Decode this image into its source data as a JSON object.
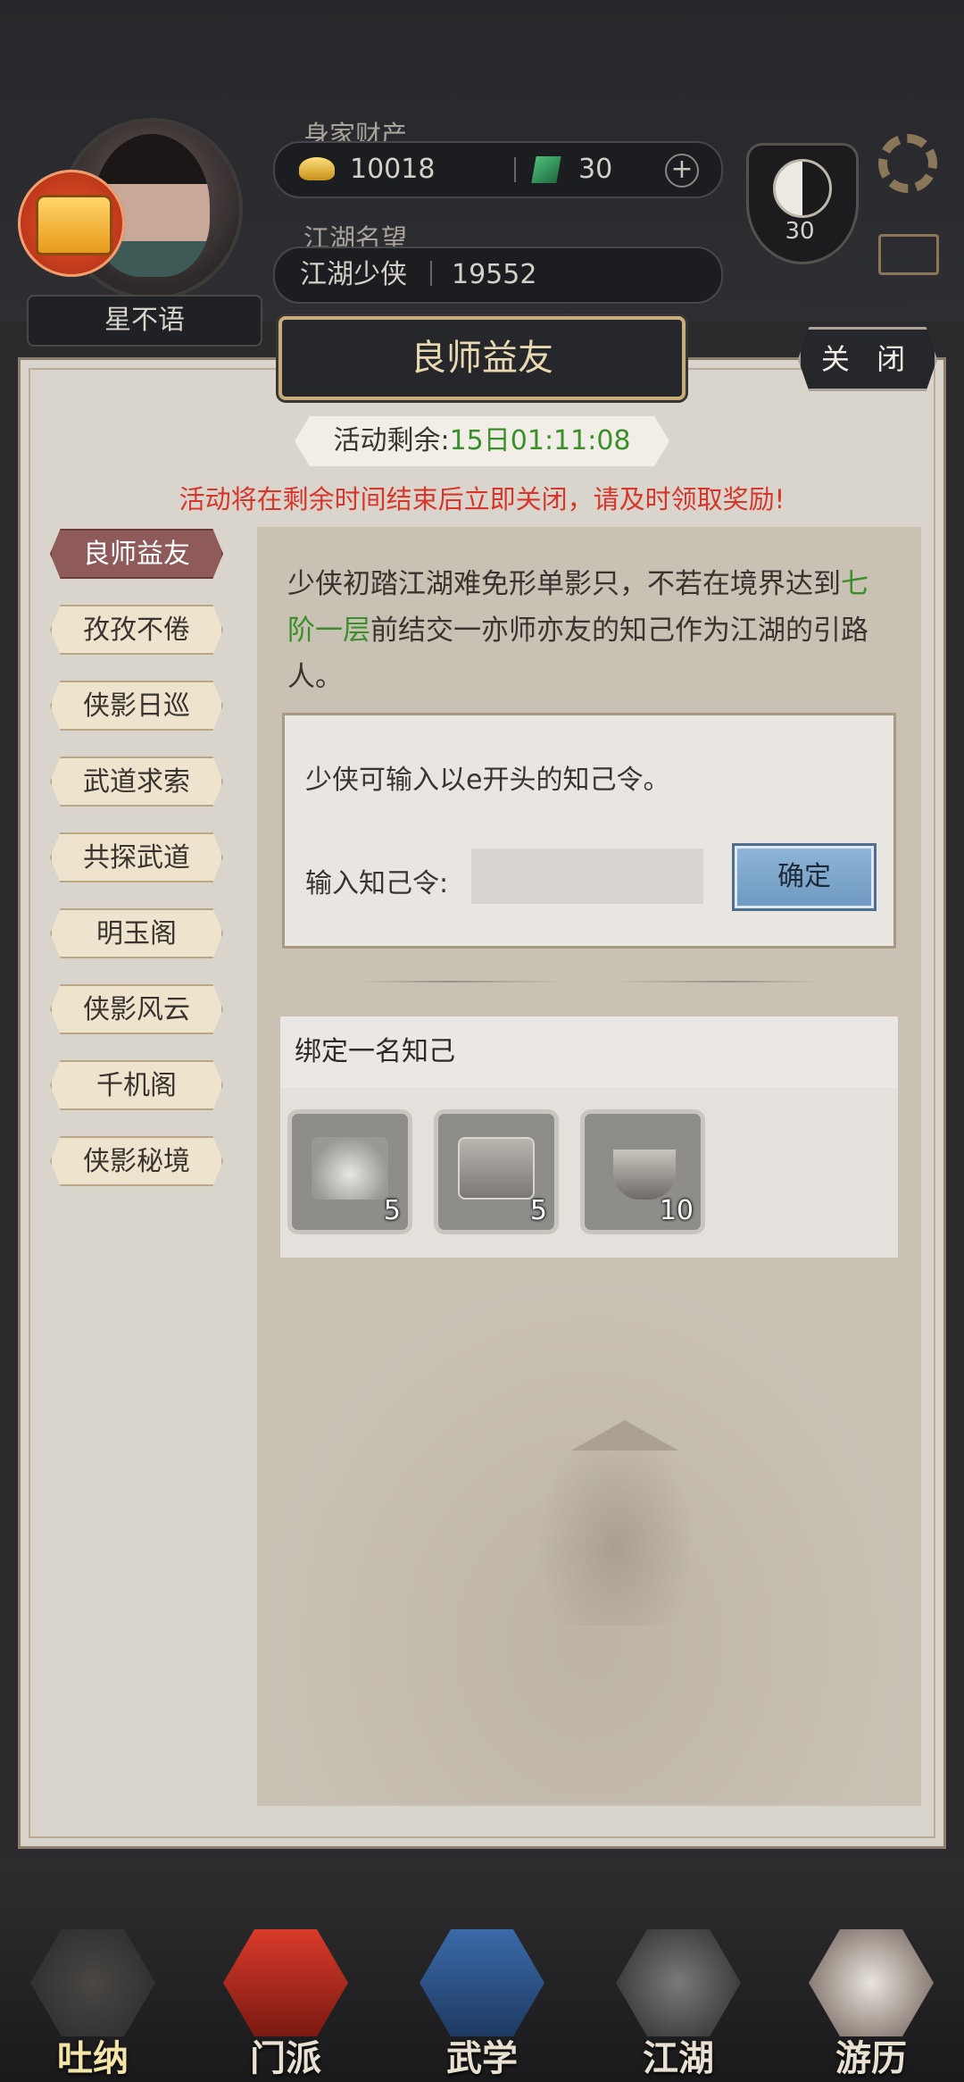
{
  "player": {
    "name": "星不语",
    "wealth_label": "身家财产",
    "gold": "10018",
    "jade": "30",
    "reputation_label": "江湖名望",
    "title": "江湖少侠",
    "reputation": "19552",
    "level": "30"
  },
  "panel": {
    "title": "良师益友",
    "close_label": "关 闭",
    "timer_label": "活动剩余:",
    "timer_value": "15日01:11:08",
    "warning": "活动将在剩余时间结束后立即关闭，请及时领取奖励!"
  },
  "tabs": [
    {
      "label": "良师益友",
      "active": true
    },
    {
      "label": "孜孜不倦"
    },
    {
      "label": "侠影日巡"
    },
    {
      "label": "武道求索"
    },
    {
      "label": "共探武道"
    },
    {
      "label": "明玉阁"
    },
    {
      "label": "侠影风云"
    },
    {
      "label": "千机阁"
    },
    {
      "label": "侠影秘境"
    }
  ],
  "content": {
    "desc_part1": "少侠初踏江湖难免形单影只，不若在境界达到",
    "desc_highlight": "七阶一层",
    "desc_part2": "前结交一亦师亦友的知己作为江湖的引路人。",
    "code_tip": "少侠可输入以e开头的知己令。",
    "code_label": "输入知己令:",
    "code_value": "",
    "confirm_label": "确定",
    "bind_title": "绑定一名知己",
    "rewards": [
      {
        "icon": "silver-ingot-icon",
        "count": "5"
      },
      {
        "icon": "treasure-chest-icon",
        "count": "5"
      },
      {
        "icon": "incense-burner-icon",
        "count": "10"
      }
    ]
  },
  "nav": [
    {
      "label": "吐纳",
      "active": true
    },
    {
      "label": "门派"
    },
    {
      "label": "武学"
    },
    {
      "label": "江湖"
    },
    {
      "label": "游历"
    }
  ]
}
